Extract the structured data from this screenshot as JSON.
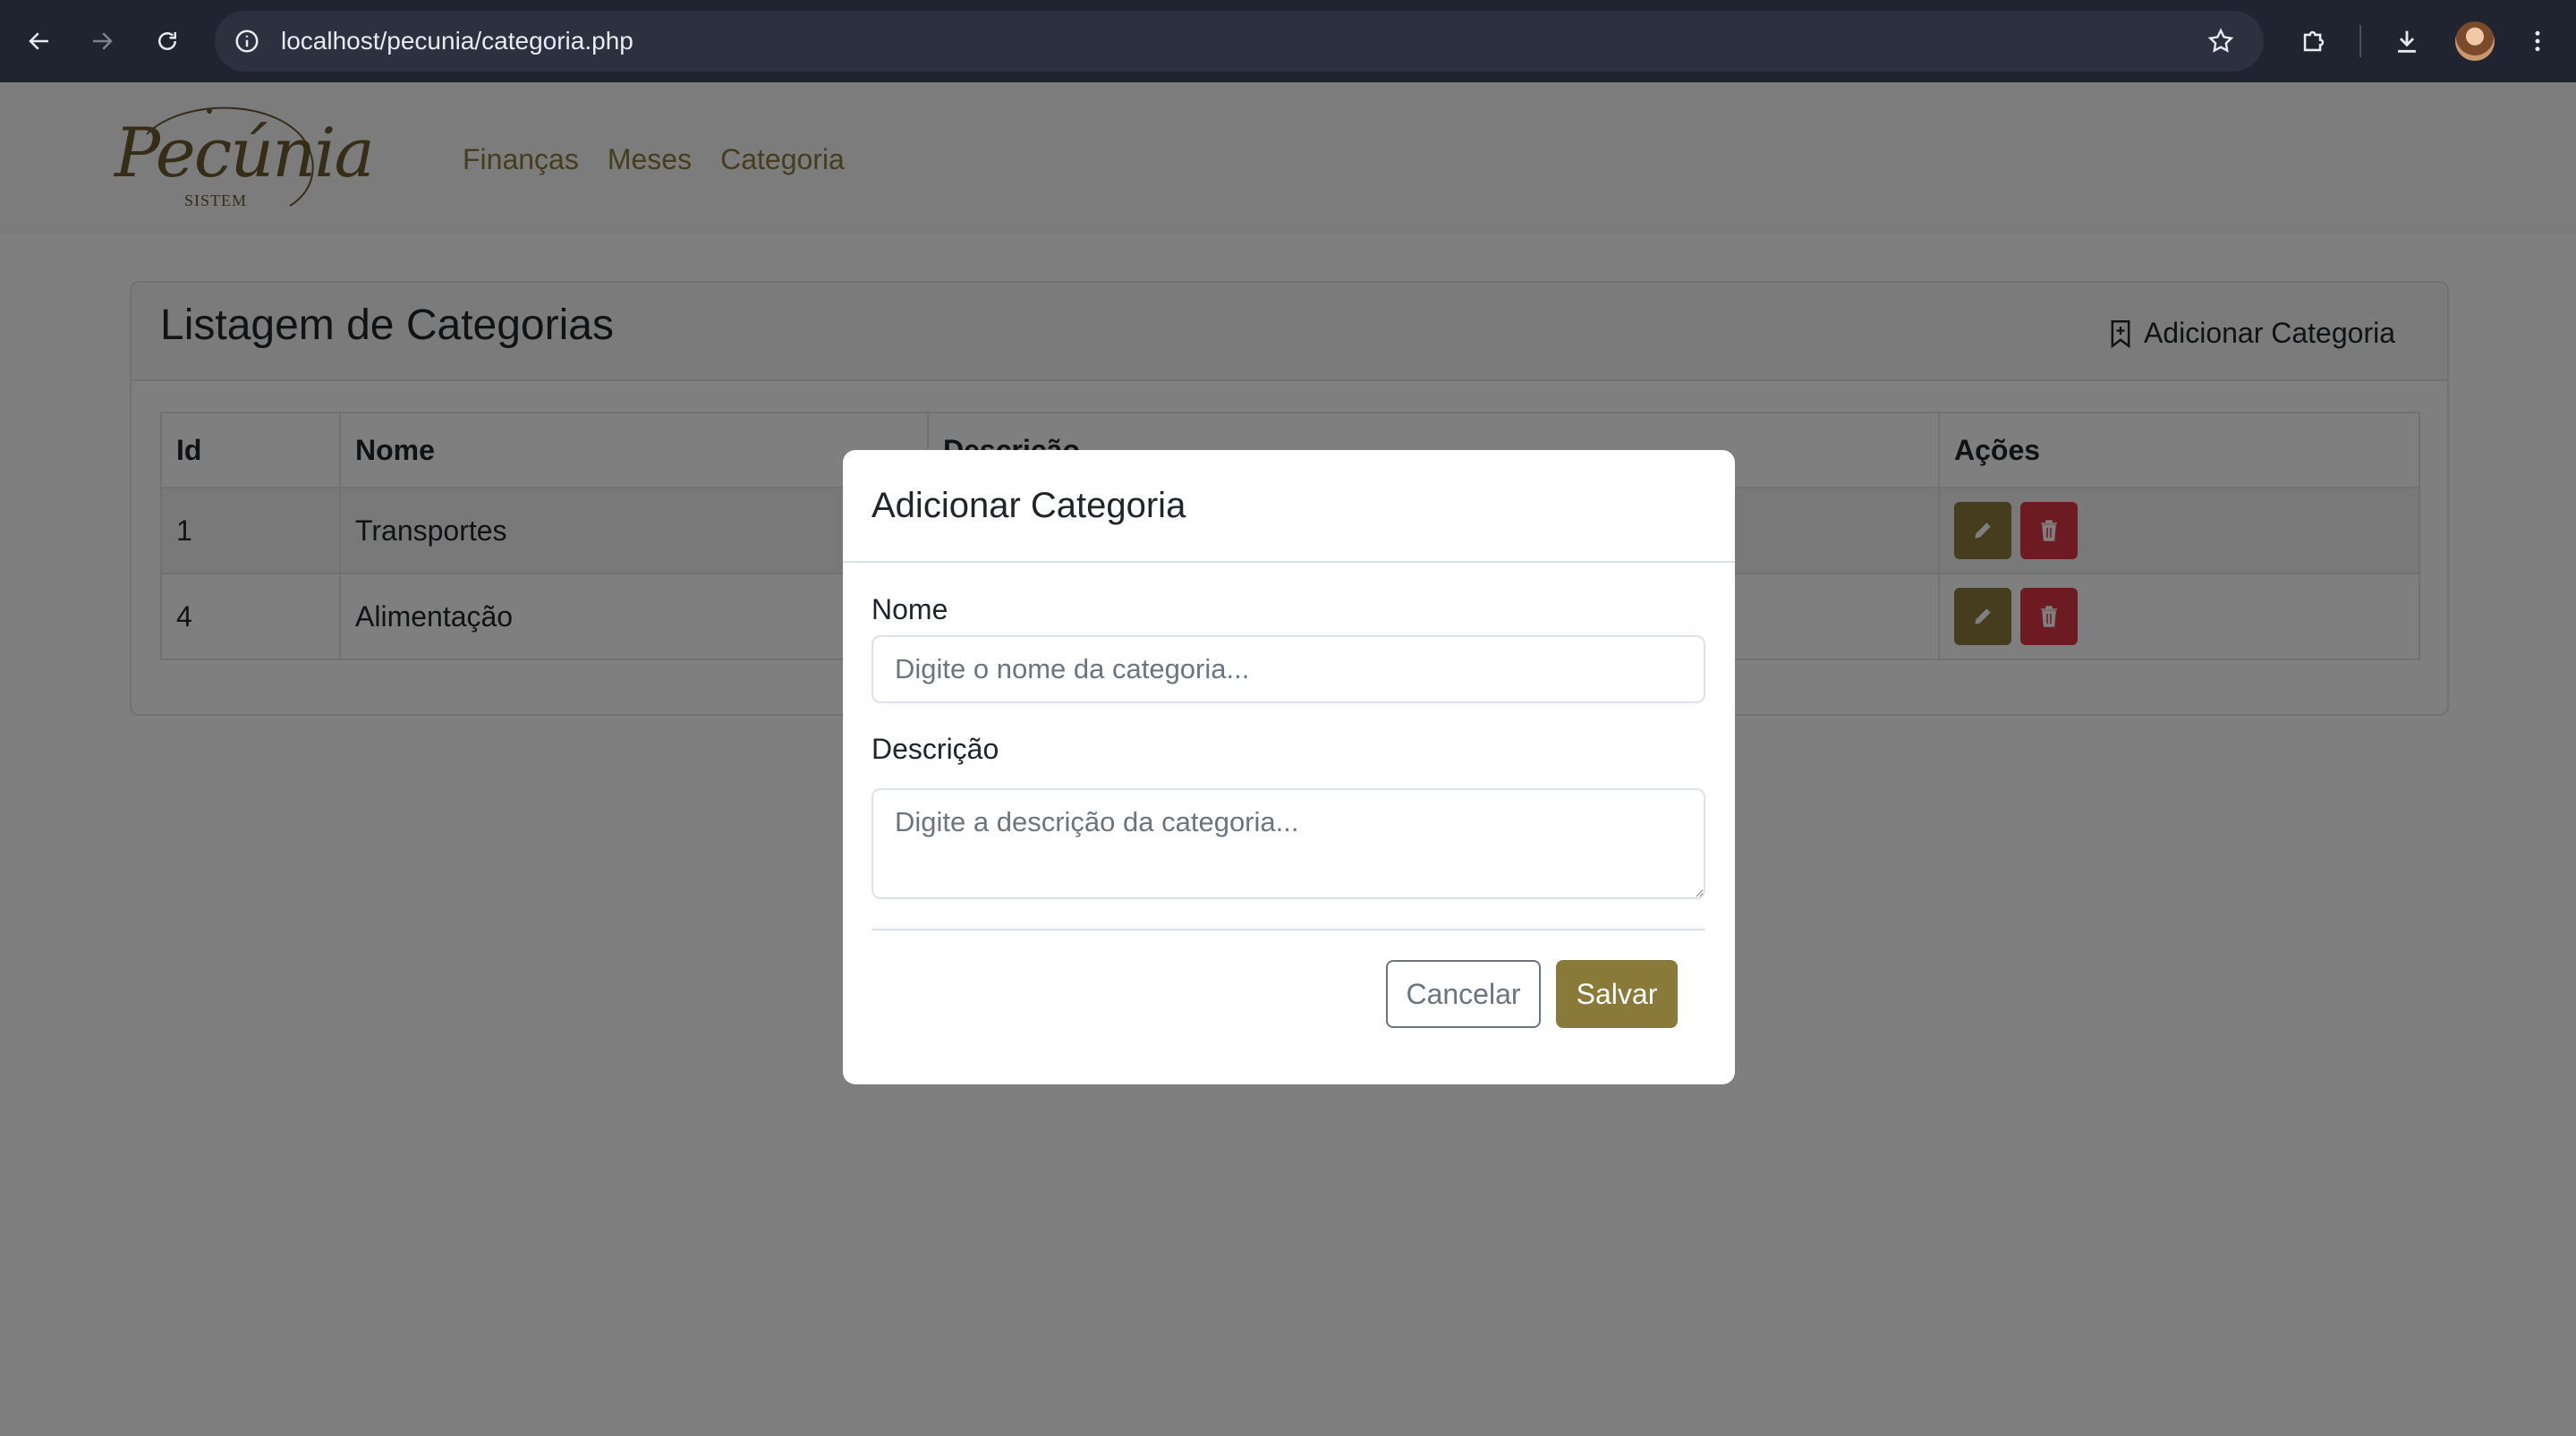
{
  "browser": {
    "url": "localhost/pecunia/categoria.php",
    "icons": [
      "back-arrow-icon",
      "forward-arrow-icon",
      "reload-icon",
      "site-info-icon",
      "bookmark-star-icon",
      "extensions-icon",
      "download-icon",
      "profile-avatar",
      "more-menu-icon"
    ]
  },
  "navbar": {
    "logo_text": "Pecúnia",
    "logo_sub": "SISTEM",
    "links": [
      "Finanças",
      "Meses",
      "Categoria"
    ]
  },
  "card": {
    "title": "Listagem de Categorias",
    "add_label": "Adicionar Categoria"
  },
  "table": {
    "headers": [
      "Id",
      "Nome",
      "Descrição",
      "Ações"
    ],
    "rows": [
      {
        "id": "1",
        "nome": "Transportes",
        "descricao": ""
      },
      {
        "id": "4",
        "nome": "Alimentação",
        "descricao": ""
      }
    ]
  },
  "modal": {
    "title": "Adicionar Categoria",
    "nome_label": "Nome",
    "nome_placeholder": "Digite o nome da categoria...",
    "nome_value": "",
    "descricao_label": "Descrição",
    "descricao_placeholder": "Digite a descrição da categoria...",
    "descricao_value": "",
    "cancel_label": "Cancelar",
    "save_label": "Salvar"
  },
  "colors": {
    "brand": "#8a7a3a",
    "danger": "#dc3545",
    "chrome": "#1f2430"
  }
}
